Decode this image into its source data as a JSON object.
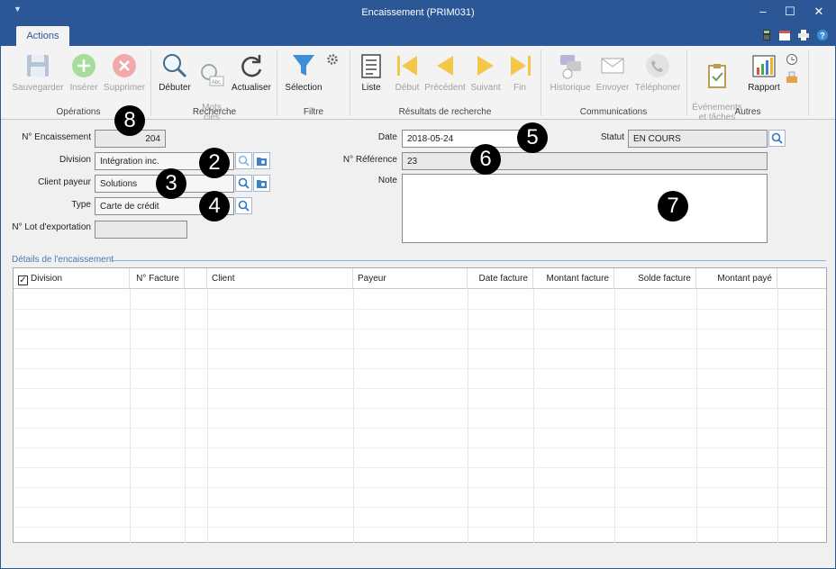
{
  "window": {
    "title": "Encaissement (PRIM031)"
  },
  "tabs": [
    {
      "label": "Actions"
    }
  ],
  "ribbon": {
    "groups": [
      {
        "label": "Opérations",
        "buttons": [
          {
            "label": "Sauvegarder"
          },
          {
            "label": "Insérer"
          },
          {
            "label": "Supprimer"
          }
        ]
      },
      {
        "label": "Recherche",
        "buttons": [
          {
            "label": "Débuter"
          },
          {
            "label": "Mots\nclés"
          },
          {
            "label": "Actualiser"
          }
        ]
      },
      {
        "label": "Filtre",
        "buttons": [
          {
            "label": "Sélection"
          }
        ]
      },
      {
        "label": "Résultats de recherche",
        "buttons": [
          {
            "label": "Liste"
          },
          {
            "label": "Début"
          },
          {
            "label": "Précédent"
          },
          {
            "label": "Suivant"
          },
          {
            "label": "Fin"
          }
        ]
      },
      {
        "label": "Communications",
        "buttons": [
          {
            "label": "Historique"
          },
          {
            "label": "Envoyer"
          },
          {
            "label": "Téléphoner"
          }
        ]
      },
      {
        "label": "Autres",
        "buttons": [
          {
            "label": "Événements\net tâches"
          },
          {
            "label": "Rapport"
          }
        ]
      }
    ]
  },
  "form": {
    "no_encaissement": {
      "label": "N° Encaissement",
      "value": "204"
    },
    "division": {
      "label": "Division",
      "value": "Intégration inc."
    },
    "client_payeur": {
      "label": "Client payeur",
      "value": "Solutions"
    },
    "type": {
      "label": "Type",
      "value": "Carte de crédit"
    },
    "no_lot": {
      "label": "N° Lot d'exportation",
      "value": ""
    },
    "date": {
      "label": "Date",
      "value": "2018-05-24"
    },
    "no_reference": {
      "label": "N° Référence",
      "value": "23"
    },
    "note": {
      "label": "Note",
      "value": ""
    },
    "statut": {
      "label": "Statut",
      "value": "EN COURS"
    }
  },
  "badges": [
    "8",
    "2",
    "3",
    "4",
    "5",
    "6",
    "7"
  ],
  "details": {
    "title": "Détails de l'encaissement",
    "columns": [
      "Division",
      "N° Facture",
      "Client",
      "Payeur",
      "Date facture",
      "Montant facture",
      "Solde facture",
      "Montant payé"
    ]
  },
  "colors": {
    "title_bar": "#2b5797",
    "accent": "#4a7ab6"
  }
}
